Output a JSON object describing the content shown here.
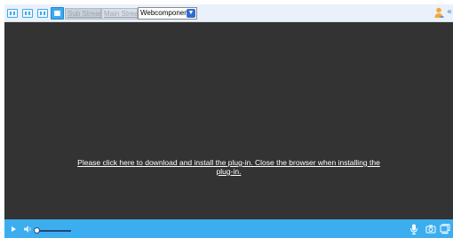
{
  "toolbar": {
    "sub_stream_label": "Sub Stream",
    "main_stream_label": "Main Stream",
    "mode_select": {
      "value": "Webcomponents",
      "options": [
        "Webcomponents"
      ]
    },
    "collapse_glyph": "«"
  },
  "viewer": {
    "plugin_message": "Please click here to download and install the plug-in. Close the browser when installing the plug-in."
  },
  "controls": {
    "volume_level": 0.1
  },
  "colors": {
    "accent": "#3caef0",
    "video_background": "#333333",
    "toolbar_background": "#eaf1fa"
  },
  "icons": [
    "layout-1x1-icon",
    "layout-2x2-icon",
    "layout-3x3-icon",
    "layout-active-icon",
    "user-icon",
    "collapse-icon",
    "play-icon",
    "volume-icon",
    "microphone-icon",
    "camera-snapshot-icon",
    "record-icon"
  ]
}
